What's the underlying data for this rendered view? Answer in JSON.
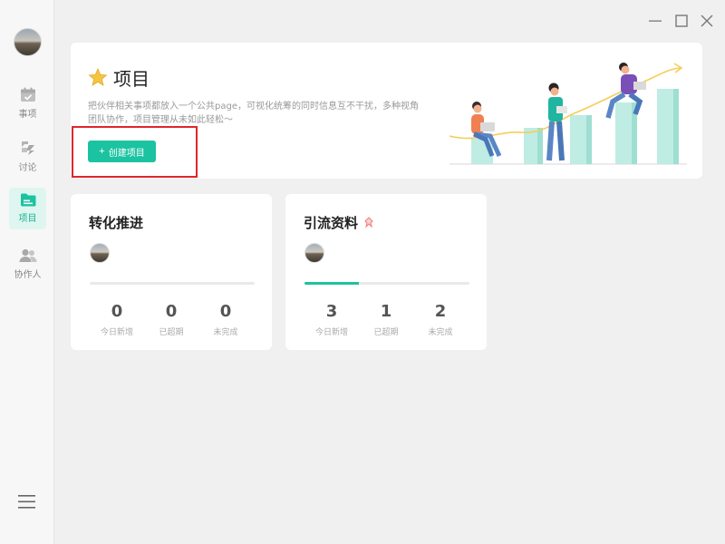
{
  "window": {
    "controls": [
      "minimize-icon",
      "maximize-icon",
      "close-icon"
    ]
  },
  "sidebar": {
    "items": [
      {
        "label": "事项",
        "icon": "calendar-check-icon",
        "active": false
      },
      {
        "label": "讨论",
        "icon": "discussion-icon",
        "active": false
      },
      {
        "label": "项目",
        "icon": "folder-icon",
        "active": true
      },
      {
        "label": "协作人",
        "icon": "people-icon",
        "active": false
      }
    ],
    "menu_icon": "menu-icon"
  },
  "banner": {
    "title": "项目",
    "title_icon": "star-icon",
    "description": "把伙伴相关事项都放入一个公共page，可视化统筹的同时信息互不干扰，多种视角团队协作，项目管理从未如此轻松～",
    "create_button_label": "创建项目",
    "create_button_icon": "plus-icon"
  },
  "projects": [
    {
      "name": "转化推进",
      "pinned": false,
      "progress": 0,
      "stats": [
        {
          "value": "0",
          "label": "今日新增"
        },
        {
          "value": "0",
          "label": "已超期"
        },
        {
          "value": "0",
          "label": "未完成"
        }
      ]
    },
    {
      "name": "引流资料",
      "pinned": true,
      "progress": 0.33,
      "stats": [
        {
          "value": "3",
          "label": "今日新增"
        },
        {
          "value": "1",
          "label": "已超期"
        },
        {
          "value": "2",
          "label": "未完成"
        }
      ]
    }
  ],
  "colors": {
    "accent": "#1cc3a0",
    "highlight": "#e0262b",
    "pin": "#f07a7a",
    "star": "#f5c542"
  }
}
